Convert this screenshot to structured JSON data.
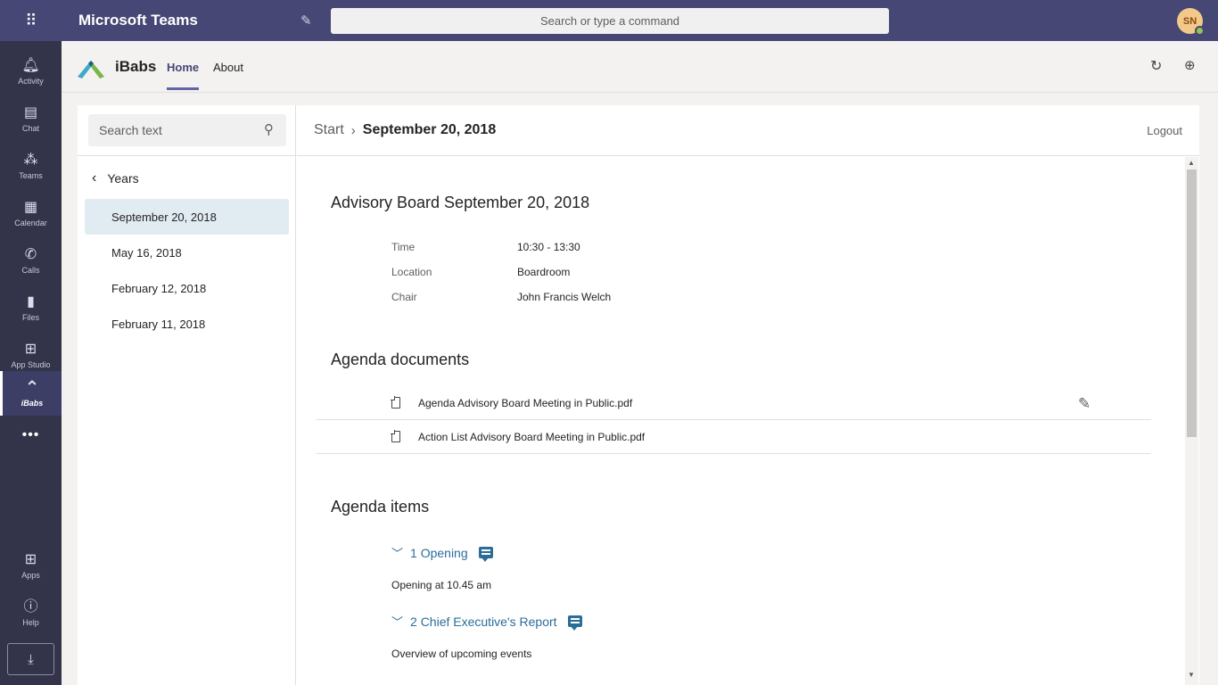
{
  "topbar": {
    "app_title": "Microsoft Teams",
    "search_placeholder": "Search or type a command",
    "avatar_initials": "SN"
  },
  "rail": {
    "items": [
      {
        "label": "Activity",
        "icon": "bell-icon"
      },
      {
        "label": "Chat",
        "icon": "chat-icon"
      },
      {
        "label": "Teams",
        "icon": "teams-icon"
      },
      {
        "label": "Calendar",
        "icon": "calendar-icon"
      },
      {
        "label": "Calls",
        "icon": "phone-icon"
      },
      {
        "label": "Files",
        "icon": "file-icon"
      },
      {
        "label": "App Studio",
        "icon": "app-studio-icon"
      },
      {
        "label": "iBabs",
        "icon": "ibabs-icon"
      },
      {
        "label": "Apps",
        "icon": "apps-icon"
      },
      {
        "label": "Help",
        "icon": "help-icon"
      }
    ],
    "more": "•••"
  },
  "app_header": {
    "name": "iBabs",
    "tabs": [
      "Home",
      "About"
    ]
  },
  "sidebar": {
    "search_placeholder": "Search text",
    "back_label": "Years",
    "dates": [
      "September 20, 2018",
      "May 16, 2018",
      "February 12, 2018",
      "February 11, 2018"
    ]
  },
  "breadcrumb": {
    "start": "Start",
    "current": "September 20, 2018",
    "logout": "Logout"
  },
  "meeting": {
    "title": "Advisory Board September 20, 2018",
    "details": [
      {
        "label": "Time",
        "value": "10:30 - 13:30"
      },
      {
        "label": "Location",
        "value": "Boardroom"
      },
      {
        "label": "Chair",
        "value": "John Francis Welch"
      }
    ]
  },
  "documents": {
    "title": "Agenda documents",
    "items": [
      "Agenda Advisory Board Meeting in Public.pdf",
      "Action List Advisory Board Meeting in Public.pdf"
    ]
  },
  "agenda": {
    "title": "Agenda items",
    "items": [
      {
        "heading": "1 Opening",
        "description": "Opening at 10.45 am"
      },
      {
        "heading": "2 Chief Executive's Report",
        "description": "Overview of upcoming events"
      }
    ]
  },
  "colors": {
    "teams_purple": "#464775",
    "rail_dark": "#33344a",
    "agenda_link": "#2b6d99",
    "active_date_bg": "#e1ebf2"
  }
}
